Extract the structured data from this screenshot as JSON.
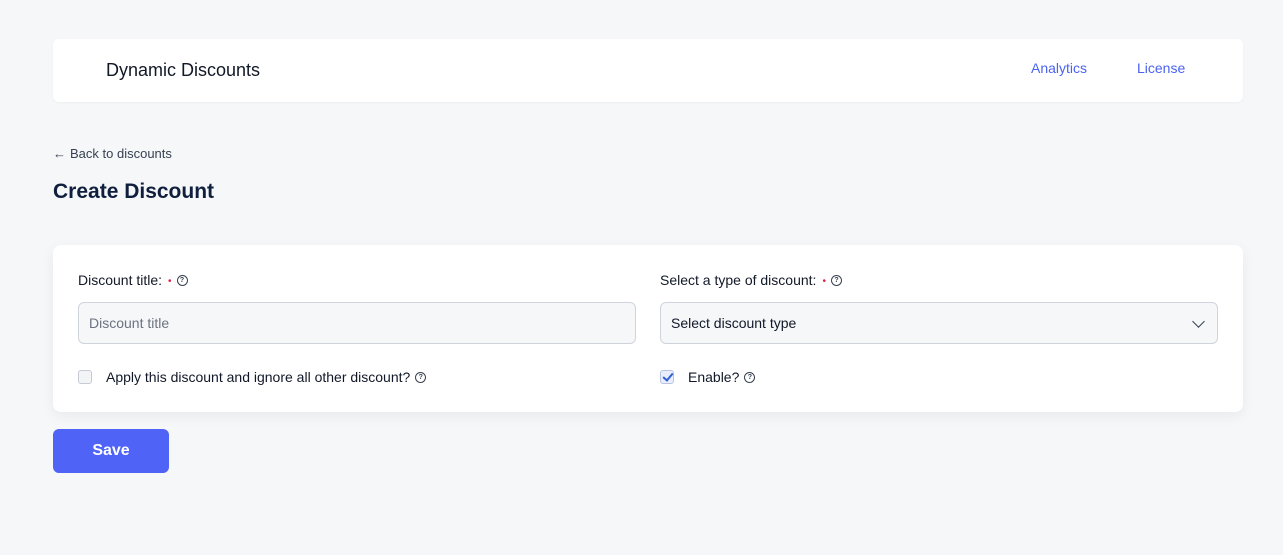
{
  "header": {
    "brand": "Dynamic Discounts",
    "nav": {
      "analytics": "Analytics",
      "license": "License"
    }
  },
  "back_link": {
    "arrow": "←",
    "label": "Back to discounts"
  },
  "page_title": "Create Discount",
  "form": {
    "title_field": {
      "label": "Discount title:",
      "required_mark": "•",
      "help": "?",
      "value": "",
      "placeholder": "Discount title"
    },
    "type_field": {
      "label": "Select a type of discount:",
      "required_mark": "•",
      "help": "?",
      "selected": "Select discount type"
    },
    "exclusive_checkbox": {
      "label": "Apply this discount and ignore all other discount?",
      "help": "?",
      "checked": false
    },
    "enable_checkbox": {
      "label": "Enable?",
      "help": "?",
      "checked": true
    }
  },
  "save_label": "Save",
  "colors": {
    "accent": "#4f63f6",
    "link": "#4a63f0",
    "required": "#e11d48",
    "background": "#f6f7f9"
  }
}
